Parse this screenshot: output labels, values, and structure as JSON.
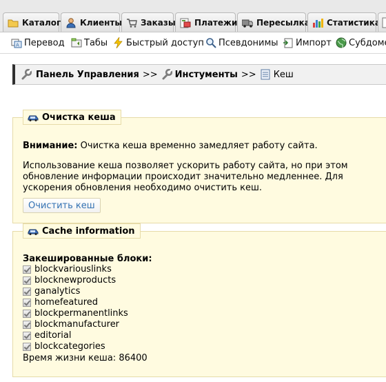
{
  "tabs": [
    {
      "label": "Каталог",
      "icon": "folder-icon"
    },
    {
      "label": "Клиенты",
      "icon": "user-icon"
    },
    {
      "label": "Заказы",
      "icon": "cart-icon"
    },
    {
      "label": "Платежи",
      "icon": "payment-icon"
    },
    {
      "label": "Пересылка",
      "icon": "truck-icon"
    },
    {
      "label": "Статистика",
      "icon": "stats-icon"
    }
  ],
  "subnav": [
    {
      "label": "Перевод",
      "icon": "translate-icon"
    },
    {
      "label": "Табы",
      "icon": "tabs-icon"
    },
    {
      "label": "Быстрый доступ",
      "icon": "lightning-icon"
    },
    {
      "label": "Псевдонимы",
      "icon": "search-icon"
    },
    {
      "label": "Импорт",
      "icon": "import-icon"
    },
    {
      "label": "Субдоме",
      "icon": "globe-icon"
    }
  ],
  "breadcrumb": {
    "root": "Панель Управления",
    "sep": ">>",
    "section": "Инстументы",
    "current": "Кеш"
  },
  "clear_cache": {
    "legend": "Очистка кеша",
    "warning_label": "Внимание:",
    "warning_text": "Очистка кеша временно замедляет работу сайта.",
    "info_line1": "Использование кеша позволяет ускорить работу сайта, но при этом",
    "info_line2": "обновление информации происходит значительно медленнее. Для",
    "info_line3": "ускорения обновления необходимо очистить кеш.",
    "button": "Очистить кеш"
  },
  "cache_info": {
    "legend": "Cache information",
    "blocks_title": "Закешированные блоки:",
    "blocks": [
      "blockvariouslinks",
      "blocknewproducts",
      "ganalytics",
      "homefeatured",
      "blockpermanentlinks",
      "blockmanufacturer",
      "editorial",
      "blockcategories"
    ],
    "lifetime_label": "Время жизни кеша:",
    "lifetime_value": "86400"
  }
}
